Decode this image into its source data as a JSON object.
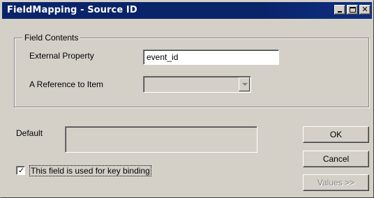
{
  "window": {
    "title": "FieldMapping - Source ID",
    "close_glyph": "✕"
  },
  "field_contents": {
    "group_label": "Field Contents",
    "external_property": {
      "label": "External Property",
      "value": "event_id"
    },
    "reference_to_item": {
      "label": "A Reference to Item",
      "value": ""
    }
  },
  "default": {
    "label": "Default",
    "value": ""
  },
  "key_binding": {
    "label": "This field is used for key binding",
    "checked": true,
    "check_glyph": "✓"
  },
  "buttons": {
    "ok": "OK",
    "cancel": "Cancel",
    "values": "Values >>"
  }
}
